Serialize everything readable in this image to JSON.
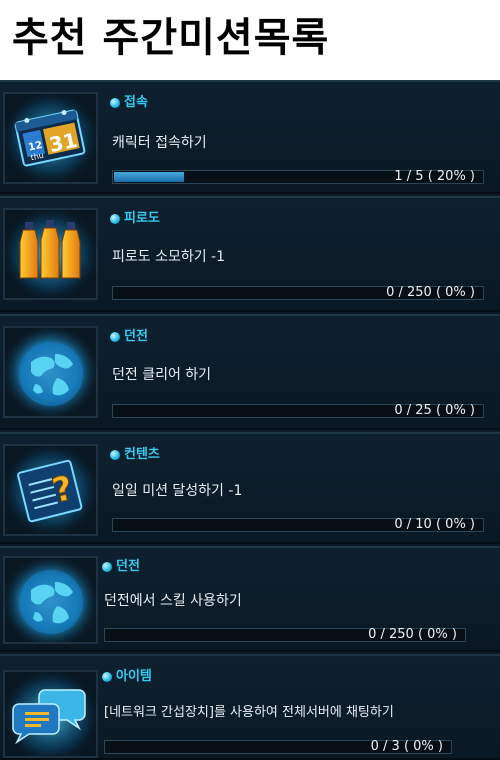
{
  "page": {
    "title": "추천 주간미션목록"
  },
  "missions": [
    {
      "category": "접속",
      "description": "캐릭터 접속하기",
      "current": 1,
      "total": 5,
      "percent": 20,
      "progress_text": "1 / 5 ( 20% )",
      "icon": "calendar-icon",
      "calendar_month": "12",
      "calendar_day": "31",
      "calendar_weekday": "thu"
    },
    {
      "category": "피로도",
      "description": "피로도 소모하기 -1",
      "current": 0,
      "total": 250,
      "percent": 0,
      "progress_text": "0 / 250 ( 0% )",
      "icon": "bottles-icon"
    },
    {
      "category": "던전",
      "description": "던전 클리어 하기",
      "current": 0,
      "total": 25,
      "percent": 0,
      "progress_text": "0 / 25 ( 0% )",
      "icon": "globe-icon"
    },
    {
      "category": "컨텐츠",
      "description": "일일 미션 달성하기 -1",
      "current": 0,
      "total": 10,
      "percent": 0,
      "progress_text": "0 / 10 ( 0% )",
      "icon": "question-document-icon"
    },
    {
      "category": "던전",
      "description": "던전에서 스킬 사용하기",
      "current": 0,
      "total": 250,
      "percent": 0,
      "progress_text": "0 / 250 ( 0% )",
      "icon": "globe-icon"
    },
    {
      "category": "아이템",
      "description": "[네트워크 간섭장치]를 사용하여 전체서버에 채팅하기",
      "current": 0,
      "total": 3,
      "percent": 0,
      "progress_text": "0 / 3 ( 0% )",
      "icon": "chat-bubbles-icon"
    }
  ],
  "colors": {
    "accent": "#38c9ee",
    "progress_fill": "#2f8ccc",
    "panel_bg": "#0b1a26"
  }
}
